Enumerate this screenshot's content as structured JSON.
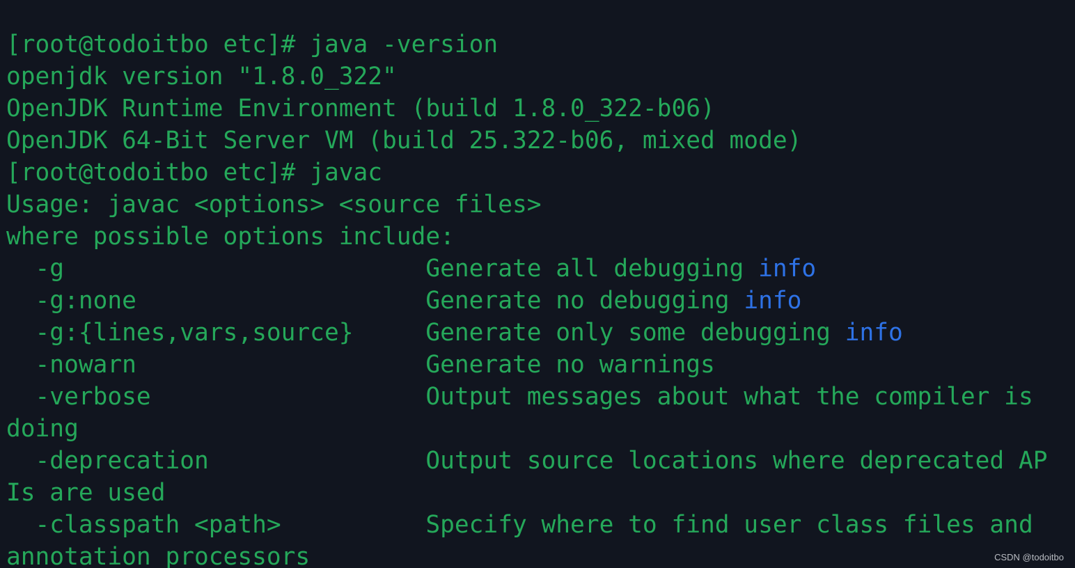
{
  "terminal": {
    "lines": [
      "[root@todoitbo etc]# java -version",
      "openjdk version \"1.8.0_322\"",
      "OpenJDK Runtime Environment (build 1.8.0_322-b06)",
      "OpenJDK 64-Bit Server VM (build 25.322-b06, mixed mode)",
      "[root@todoitbo etc]# javac",
      "Usage: javac <options> <source files>",
      "where possible options include:",
      {
        "text": "  -g                         Generate all debugging ",
        "keyword": "info"
      },
      {
        "text": "  -g:none                    Generate no debugging ",
        "keyword": "info"
      },
      {
        "text": "  -g:{lines,vars,source}     Generate only some debugging ",
        "keyword": "info"
      },
      "  -nowarn                    Generate no warnings",
      "  -verbose                   Output messages about what the compiler is",
      "doing",
      "  -deprecation               Output source locations where deprecated AP",
      "Is are used",
      "  -classpath <path>          Specify where to find user class files and",
      "annotation processors"
    ],
    "colors": {
      "background": "#11151f",
      "text": "#25a85a",
      "keyword": "#2e72e6"
    }
  },
  "watermark": "CSDN @todoitbo"
}
